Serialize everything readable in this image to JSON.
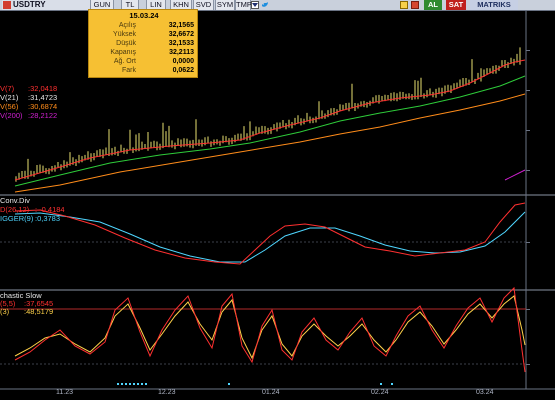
{
  "toolbar": {
    "symbol": "USDTRY",
    "buttons": [
      "GUN",
      "TL",
      "LIN",
      "KHN",
      "SVD",
      "SYM",
      "TMP"
    ],
    "al_label": "AL",
    "sat_label": "SAT",
    "matriks_label": "MATRIKS",
    "colors": {
      "al": "#2f8a2f",
      "sat": "#c0201c",
      "matriks": "#c6cfe4"
    }
  },
  "infobox": {
    "date": "15.03.24",
    "rows": [
      {
        "label": "Açılış",
        "value": "32,1565"
      },
      {
        "label": "Yüksek",
        "value": "32,6672"
      },
      {
        "label": "Düşük",
        "value": "32,1533"
      },
      {
        "label": "Kapanış",
        "value": "32,2113"
      },
      {
        "label": "Ağ. Ort",
        "value": "0,0000"
      },
      {
        "label": "Fark",
        "value": "0,0622"
      }
    ]
  },
  "price_legend": [
    {
      "label": "V(7)",
      "value": ":32,0418",
      "color": "#ff3030"
    },
    {
      "label": "V(21)",
      "value": ":31,4723",
      "color": "#e8e8e8"
    },
    {
      "label": "V(56)",
      "value": ":30,6874",
      "color": "#ff8c1a"
    },
    {
      "label": "V(200)",
      "value": ":28,2122",
      "color": "#d020d0"
    }
  ],
  "macd_legend": [
    {
      "label": "Conv.Div",
      "value": "",
      "color": "#e8e8e8"
    },
    {
      "label": "D(26,12)",
      "value": ": -0,4184",
      "color": "#ff3030"
    },
    {
      "label": "IGGER(9)",
      "value": ":0,3783",
      "color": "#4fd6ff"
    }
  ],
  "stoch_legend": [
    {
      "label": "chastic Slow",
      "value": "",
      "color": "#e8e8e8"
    },
    {
      "label": "(5,5)",
      "value": ":37,6545",
      "color": "#ff3030"
    },
    {
      "label": "(3)",
      "value": ":48,5179",
      "color": "#ffd24a"
    }
  ],
  "x_axis": [
    "11.23",
    "12.23",
    "01.24",
    "02.24",
    "03.24"
  ],
  "chart_data": [
    {
      "type": "line",
      "title": "USDTRY",
      "series": [
        {
          "name": "V(7)",
          "color": "#ff3030"
        },
        {
          "name": "V(21)",
          "color": "#e8e8e8"
        },
        {
          "name": "V(56)",
          "color": "#ff8c1a"
        },
        {
          "name": "V(200)",
          "color": "#d020d0"
        }
      ]
    },
    {
      "type": "line",
      "series": [
        {
          "name": "D(26,12)",
          "color": "#ff3030"
        },
        {
          "name": "IGGER(9)",
          "color": "#4fd6ff"
        }
      ]
    },
    {
      "type": "line",
      "series": [
        {
          "name": "(5,5)",
          "color": "#ff3030"
        },
        {
          "name": "(3)",
          "color": "#ffd24a"
        }
      ]
    }
  ]
}
